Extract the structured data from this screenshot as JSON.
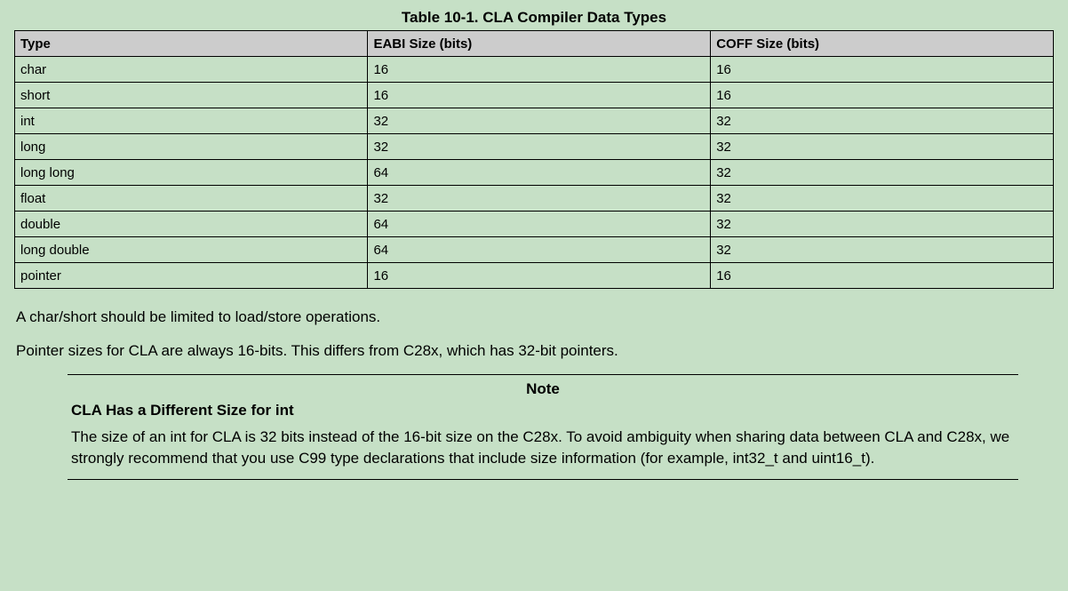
{
  "table": {
    "title": "Table 10-1. CLA Compiler Data Types",
    "headers": [
      "Type",
      "EABI Size (bits)",
      "COFF Size (bits)"
    ],
    "rows": [
      {
        "type": "char",
        "eabi": "16",
        "coff": "16"
      },
      {
        "type": "short",
        "eabi": "16",
        "coff": "16"
      },
      {
        "type": "int",
        "eabi": "32",
        "coff": "32"
      },
      {
        "type": "long",
        "eabi": "32",
        "coff": "32"
      },
      {
        "type": "long long",
        "eabi": "64",
        "coff": "32"
      },
      {
        "type": "float",
        "eabi": "32",
        "coff": "32"
      },
      {
        "type": "double",
        "eabi": "64",
        "coff": "32"
      },
      {
        "type": "long double",
        "eabi": "64",
        "coff": "32"
      },
      {
        "type": "pointer",
        "eabi": "16",
        "coff": "16"
      }
    ]
  },
  "paragraphs": [
    "A char/short should be limited to load/store operations.",
    "Pointer sizes for CLA are always 16-bits. This differs from C28x, which has 32-bit pointers."
  ],
  "note": {
    "heading": "Note",
    "subheading": "CLA Has a Different Size for int",
    "body": "The size of an int for CLA is 32 bits instead of the 16-bit size on the C28x. To avoid ambiguity when sharing data between CLA and C28x, we strongly recommend that you use C99 type declarations that include size information (for example, int32_t and uint16_t)."
  }
}
